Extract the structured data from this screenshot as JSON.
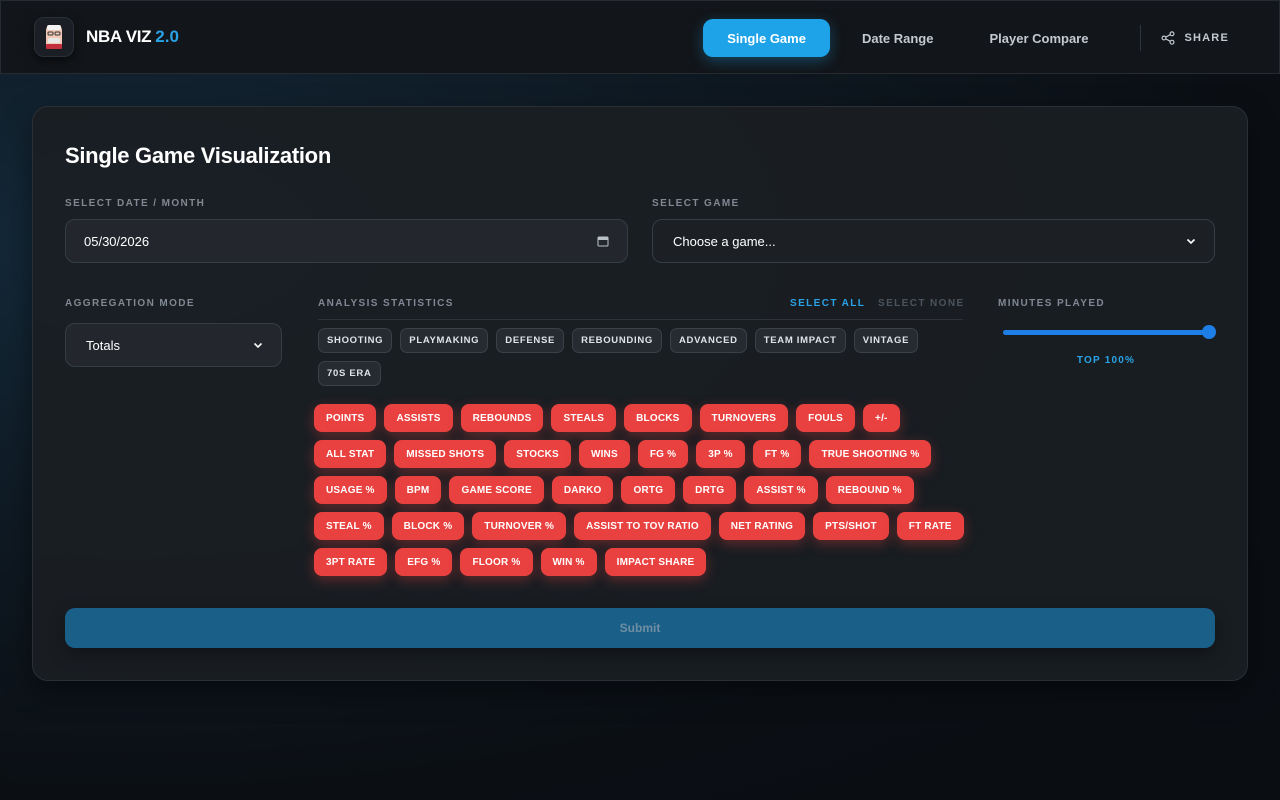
{
  "brand": {
    "name": "NBA VIZ",
    "version": "2.0"
  },
  "nav": {
    "tabs": [
      {
        "label": "Single Game",
        "active": true
      },
      {
        "label": "Date Range",
        "active": false
      },
      {
        "label": "Player Compare",
        "active": false
      }
    ],
    "share_label": "SHARE"
  },
  "card": {
    "title": "Single Game Visualization",
    "date": {
      "label": "SELECT DATE / MONTH",
      "value": "05/30/2026"
    },
    "game": {
      "label": "SELECT GAME",
      "value": "Choose a game..."
    },
    "aggregation": {
      "label": "AGGREGATION MODE",
      "value": "Totals"
    },
    "stats": {
      "label": "ANALYSIS STATISTICS",
      "select_all": "SELECT ALL",
      "select_none": "SELECT NONE",
      "categories": [
        "SHOOTING",
        "PLAYMAKING",
        "DEFENSE",
        "REBOUNDING",
        "ADVANCED",
        "TEAM IMPACT",
        "VINTAGE",
        "70S ERA"
      ],
      "chips": [
        "POINTS",
        "ASSISTS",
        "REBOUNDS",
        "STEALS",
        "BLOCKS",
        "TURNOVERS",
        "FOULS",
        "+/-",
        "ALL STAT",
        "MISSED SHOTS",
        "STOCKS",
        "WINS",
        "FG %",
        "3P %",
        "FT %",
        "TRUE SHOOTING %",
        "USAGE %",
        "BPM",
        "GAME SCORE",
        "DARKO",
        "ORTG",
        "DRTG",
        "ASSIST %",
        "REBOUND %",
        "STEAL %",
        "BLOCK %",
        "TURNOVER %",
        "ASSIST TO TOV RATIO",
        "NET RATING",
        "PTS/SHOT",
        "FT RATE",
        "3PT RATE",
        "EFG %",
        "FLOOR %",
        "WIN %",
        "IMPACT SHARE"
      ]
    },
    "minutes": {
      "label": "MINUTES PLAYED",
      "value_label": "TOP 100%",
      "fraction": 1.0
    },
    "submit_label": "Submit"
  },
  "colors": {
    "accent": "#1fa3e8",
    "chip": "#e8413f",
    "submit": "#1a5f88",
    "slider": "#1d7fe6"
  },
  "icons": {
    "logo": "player-avatar-icon",
    "share": "share-icon",
    "calendar": "calendar-icon",
    "chevron": "chevron-down-icon"
  }
}
